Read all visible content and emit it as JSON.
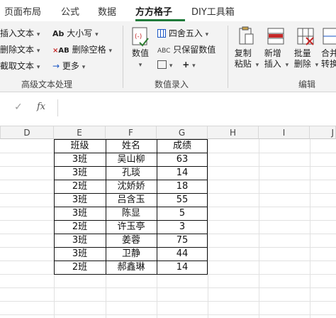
{
  "tabs": [
    {
      "label": "页面布局",
      "active": false
    },
    {
      "label": "公式",
      "active": false
    },
    {
      "label": "数据",
      "active": false
    },
    {
      "label": "方方格子",
      "active": true
    },
    {
      "label": "DIY工具箱",
      "active": false
    }
  ],
  "ribbon": {
    "text_group": {
      "insert_text": "插入文本",
      "delete_text": "删除文本",
      "extract_text": "截取文本",
      "case": "大小写",
      "delete_spaces": "删除空格",
      "more": "更多",
      "group_label": "高级文本处理"
    },
    "number_group": {
      "numeric": "数值",
      "round": "四舍五入",
      "keep_numeric": "只保留数值",
      "group_label": "数值录入"
    },
    "edit_group": {
      "copy_paste": "复制粘贴",
      "insert_new": "新增插入",
      "batch_delete": "批量删除",
      "merge_convert": "合并转换",
      "group_label": "编辑"
    }
  },
  "formula_bar": {
    "fx": "fx",
    "check": "✓",
    "value": ""
  },
  "columns": [
    "D",
    "E",
    "F",
    "G",
    "H",
    "I",
    "J"
  ],
  "table": {
    "headers": [
      "班级",
      "姓名",
      "成绩"
    ],
    "rows": [
      [
        "3班",
        "吴山柳",
        "63"
      ],
      [
        "3班",
        "孔琰",
        "14"
      ],
      [
        "2班",
        "沈娇娇",
        "18"
      ],
      [
        "3班",
        "吕含玉",
        "55"
      ],
      [
        "3班",
        "陈显",
        "5"
      ],
      [
        "2班",
        "许玉亭",
        "3"
      ],
      [
        "3班",
        "姜蓉",
        "75"
      ],
      [
        "3班",
        "卫静",
        "44"
      ],
      [
        "2班",
        "郝鑫琳",
        "14"
      ]
    ]
  }
}
